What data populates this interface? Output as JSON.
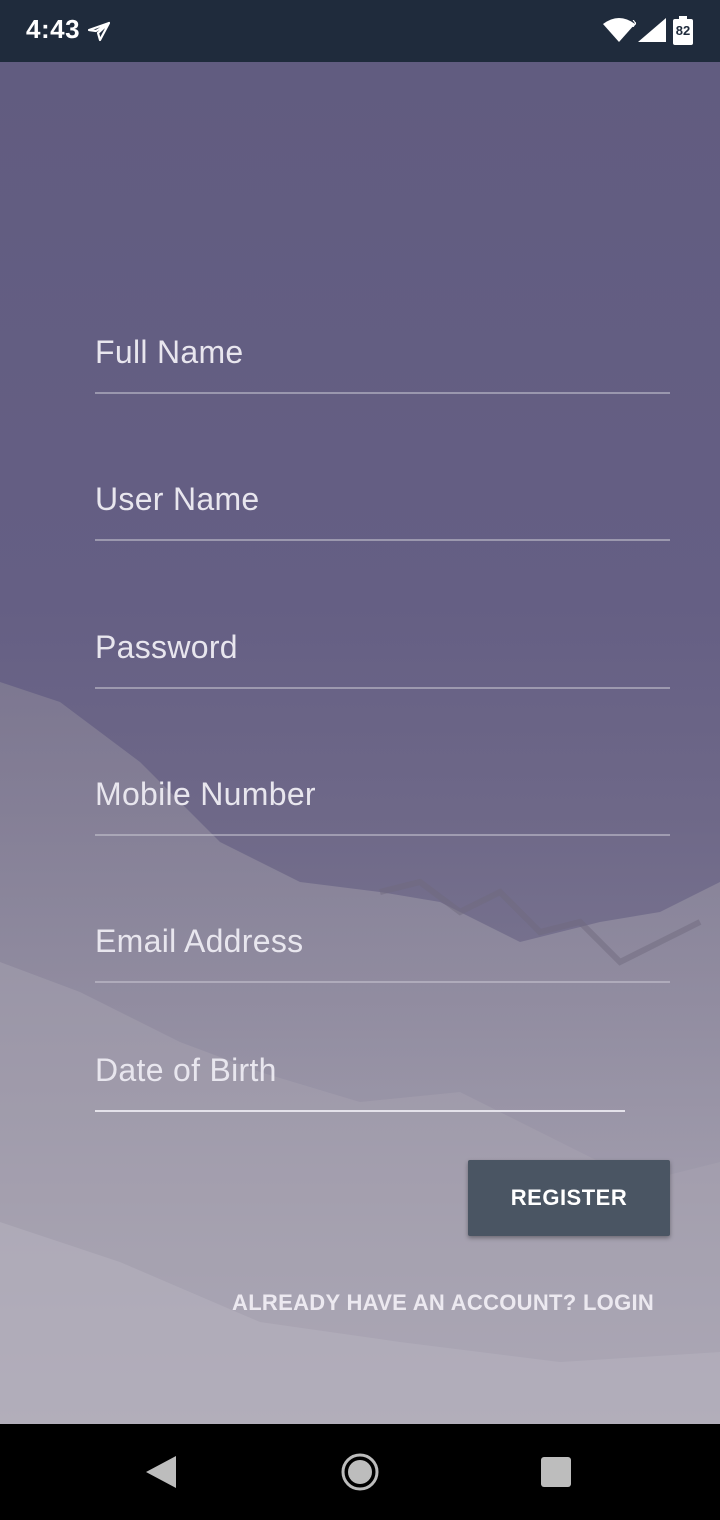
{
  "status_bar": {
    "time": "4:43",
    "battery": "82",
    "icons": [
      "send-icon",
      "wifi-icon",
      "signal-icon",
      "battery-icon"
    ]
  },
  "form": {
    "fields": [
      {
        "placeholder": "Full Name"
      },
      {
        "placeholder": "User Name"
      },
      {
        "placeholder": "Password"
      },
      {
        "placeholder": "Mobile Number"
      },
      {
        "placeholder": "Email Address"
      },
      {
        "placeholder": "Date of Birth"
      }
    ],
    "register_label": "REGISTER",
    "login_link": "ALREADY HAVE AN ACCOUNT? LOGIN"
  },
  "nav_bar": {
    "icons": [
      "back-icon",
      "home-icon",
      "recents-icon"
    ]
  },
  "colors": {
    "status_bar": "#1f2b3c",
    "background_overlay": "#615c80",
    "button": "#4a5563",
    "text": "#e8e6ee"
  }
}
